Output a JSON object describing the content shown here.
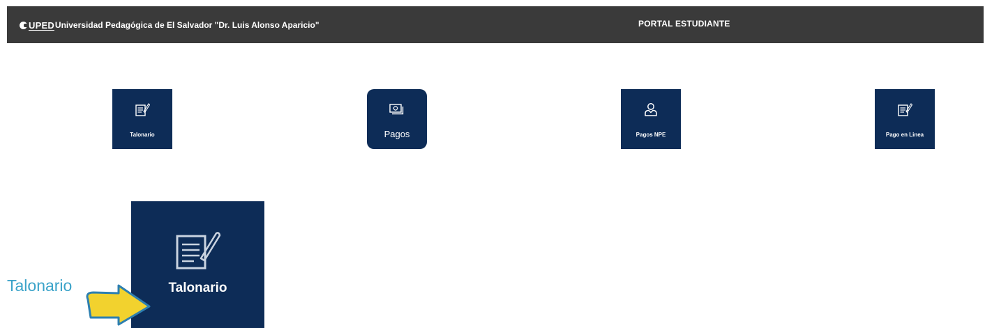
{
  "header": {
    "logo_text": "UPED",
    "university_name": "Universidad Pedagógica de El Salvador \"Dr. Luis Alonso Aparicio\"",
    "portal_title": "PORTAL ESTUDIANTE"
  },
  "menu": {
    "items": [
      {
        "label": "Talonario",
        "icon": "document-pen-icon"
      },
      {
        "label": "Pagos",
        "icon": "money-bill-icon"
      },
      {
        "label": "Pagos NPE",
        "icon": "user-icon"
      },
      {
        "label": "Pago en Linea",
        "icon": "document-pen-icon"
      }
    ]
  },
  "zoom": {
    "tile_label": "Talonario",
    "callout_label": "Talonario",
    "arrow_color": "#f2d22e",
    "callout_color": "#3ba3c9"
  },
  "colors": {
    "header_bg": "#3a3a3a",
    "tile_bg": "#0d2c57"
  }
}
